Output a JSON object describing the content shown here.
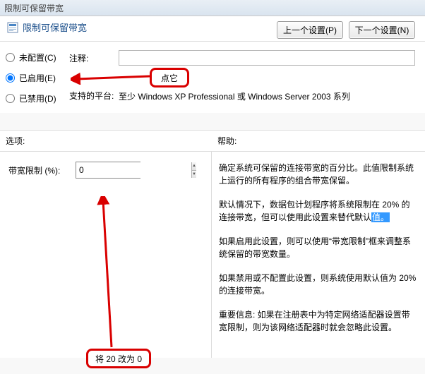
{
  "titlebar": "限制可保留带宽",
  "header": {
    "title": "限制可保留带宽"
  },
  "nav": {
    "prev": "上一个设置(P)",
    "next": "下一个设置(N)"
  },
  "radios": {
    "unconfigured": "未配置(C)",
    "enabled": "已启用(E)",
    "disabled": "已禁用(D)"
  },
  "meta": {
    "comment_label": "注释:",
    "comment_value": "",
    "platform_label": "支持的平台:",
    "platform_value": "至少 Windows XP Professional 或 Windows Server 2003 系列"
  },
  "sections": {
    "options": "选项:",
    "help": "帮助:"
  },
  "options": {
    "bandwidth_label": "带宽限制 (%):",
    "bandwidth_value": "0"
  },
  "help": {
    "p1": "确定系统可保留的连接带宽的百分比。此值限制系统上运行的所有程序的组合带宽保留。",
    "p2a": "默认情况下，数据包计划程序将系统限制在 20% 的连接带宽，但可以使用此设置来替代默认",
    "p2b": "值。",
    "p3": "如果启用此设置，则可以使用“带宽限制”框来调整系统保留的带宽数量。",
    "p4": "如果禁用或不配置此设置，则系统使用默认值为 20% 的连接带宽。",
    "p5": "重要信息: 如果在注册表中为特定网络适配器设置带宽限制，则为该网络适配器时就会忽略此设置。"
  },
  "annotations": {
    "click_it": "点它",
    "change": "将 20 改为 0"
  }
}
